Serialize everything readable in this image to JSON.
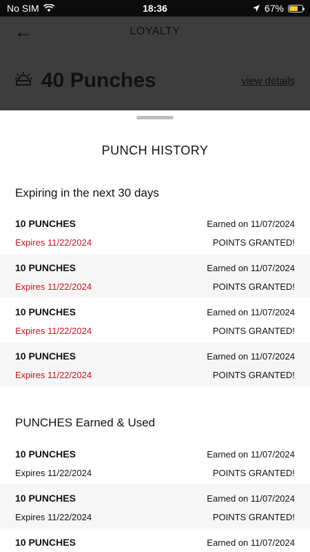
{
  "status_bar": {
    "carrier": "No SIM",
    "time": "18:36",
    "battery": "67%",
    "battery_level": 0.67
  },
  "header": {
    "back_icon": "back-arrow-icon",
    "title": "LOYALTY"
  },
  "summary": {
    "icon": "sunrise-punch-icon",
    "count_label": "40 Punches",
    "view_details": "view details"
  },
  "sheet": {
    "title": "PUNCH HISTORY",
    "expiring": {
      "title": "Expiring in the next 30 days",
      "rows": [
        {
          "label": "10 PUNCHES",
          "earned": "Earned on 11/07/2024",
          "expires": "Expires 11/22/2024",
          "status": "POINTS GRANTED!"
        },
        {
          "label": "10 PUNCHES",
          "earned": "Earned on 11/07/2024",
          "expires": "Expires 11/22/2024",
          "status": "POINTS GRANTED!"
        },
        {
          "label": "10 PUNCHES",
          "earned": "Earned on 11/07/2024",
          "expires": "Expires 11/22/2024",
          "status": "POINTS GRANTED!"
        },
        {
          "label": "10 PUNCHES",
          "earned": "Earned on 11/07/2024",
          "expires": "Expires 11/22/2024",
          "status": "POINTS GRANTED!"
        }
      ]
    },
    "earned_used": {
      "title": "PUNCHES Earned & Used",
      "rows": [
        {
          "label": "10 PUNCHES",
          "earned": "Earned on 11/07/2024",
          "expires": "Expires 11/22/2024",
          "status": "POINTS GRANTED!"
        },
        {
          "label": "10 PUNCHES",
          "earned": "Earned on 11/07/2024",
          "expires": "Expires 11/22/2024",
          "status": "POINTS GRANTED!"
        },
        {
          "label": "10 PUNCHES",
          "earned": "Earned on 11/07/2024"
        }
      ]
    }
  },
  "colors": {
    "expiring_red": "#c5161d",
    "overlay": "#3d3d3d",
    "alt_row": "#f6f6f6",
    "battery": "#f5cc2a"
  }
}
